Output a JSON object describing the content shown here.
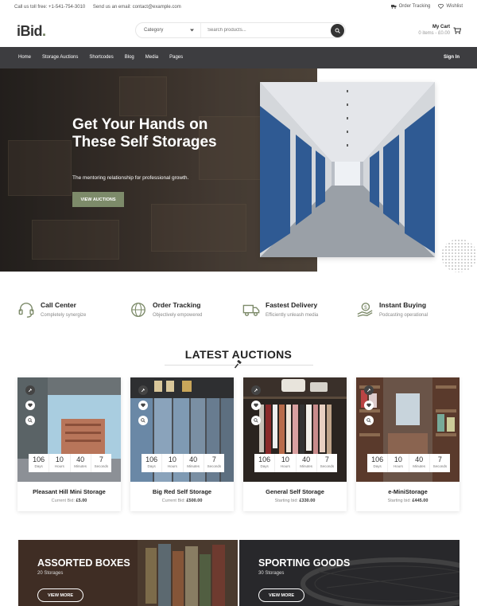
{
  "topbar": {
    "phone": "Call us toll free: +1-541-754-3010",
    "email": "Send us an email: contact@example.com",
    "order_tracking": "Order Tracking",
    "wishlist": "Wishlist"
  },
  "header": {
    "logo": "iBid",
    "logo_dot": ".",
    "category": "Category",
    "search_placeholder": "Search products...",
    "cart_title": "My Cart",
    "cart_summary": "0 items - £0.00"
  },
  "nav": {
    "items": [
      "Home",
      "Storage Auctions",
      "Shortcodes",
      "Blog",
      "Media",
      "Pages"
    ],
    "signin": "Sign In"
  },
  "hero": {
    "title": "Get Your Hands on These Self Storages",
    "subtitle": "The mentoring relationship for professional growth.",
    "button": "VIEW AUCTIONS"
  },
  "features": [
    {
      "title": "Call Center",
      "subtitle": "Completely synergize",
      "icon": "headset-icon"
    },
    {
      "title": "Order Tracking",
      "subtitle": "Objectively empowered",
      "icon": "globe-icon"
    },
    {
      "title": "Fastest Delivery",
      "subtitle": "Efficiently unleash media",
      "icon": "truck-icon"
    },
    {
      "title": "Instant Buying",
      "subtitle": "Podcasting operational",
      "icon": "hand-money-icon"
    }
  ],
  "latest": {
    "title": "LATEST AUCTIONS"
  },
  "timer_units": {
    "d": "Days",
    "h": "Hours",
    "m": "Minutes",
    "s": "Seconds"
  },
  "cards": [
    {
      "name": "Pleasant Hill Mini Storage",
      "bid_label": "Current Bid:",
      "bid": "£5.00",
      "days": "106",
      "hours": "10",
      "minutes": "40",
      "seconds": "7"
    },
    {
      "name": "Big Red Self Storage",
      "bid_label": "Current Bid:",
      "bid": "£500.00",
      "days": "106",
      "hours": "10",
      "minutes": "40",
      "seconds": "7"
    },
    {
      "name": "General Self Storage",
      "bid_label": "Starting bid:",
      "bid": "£330.00",
      "days": "106",
      "hours": "10",
      "minutes": "40",
      "seconds": "7"
    },
    {
      "name": "e-MiniStorage",
      "bid_label": "Starting bid:",
      "bid": "£445.00",
      "days": "106",
      "hours": "10",
      "minutes": "40",
      "seconds": "7"
    }
  ],
  "categories": [
    {
      "title": "ASSORTED BOXES",
      "count": "20 Storages",
      "button": "VIEW MORE"
    },
    {
      "title": "SPORTING GOODS",
      "count": "30 Storages",
      "button": "VIEW MORE"
    }
  ],
  "colors": {
    "accent": "#7d8b6a",
    "nav_bg": "#3d3d40",
    "dark_text": "#222222"
  }
}
